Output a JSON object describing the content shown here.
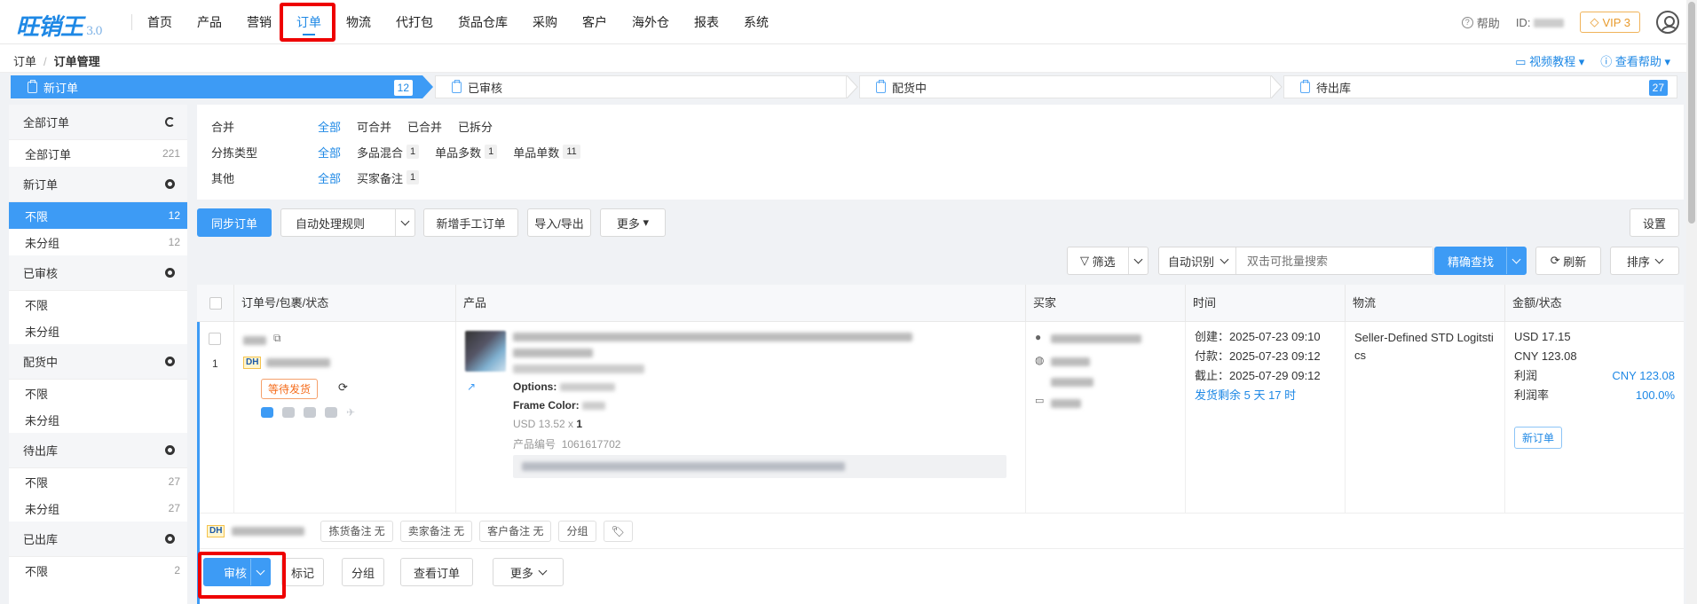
{
  "app": {
    "logo": "旺销王",
    "version": "3.0"
  },
  "nav": [
    {
      "label": "首页"
    },
    {
      "label": "产品"
    },
    {
      "label": "营销"
    },
    {
      "label": "订单"
    },
    {
      "label": "物流"
    },
    {
      "label": "代打包"
    },
    {
      "label": "货品仓库"
    },
    {
      "label": "采购"
    },
    {
      "label": "客户"
    },
    {
      "label": "海外仓"
    },
    {
      "label": "报表"
    },
    {
      "label": "系统"
    }
  ],
  "topRight": {
    "help": "帮助",
    "idLabel": "ID:",
    "vip": "VIP 3"
  },
  "breadcrumb": {
    "root": "订单",
    "sep": "/",
    "current": "订单管理"
  },
  "crumbRight": {
    "video": "视频教程",
    "help": "查看帮助"
  },
  "steps": [
    {
      "label": "新订单",
      "count": "12"
    },
    {
      "label": "已审核",
      "count": ""
    },
    {
      "label": "配货中",
      "count": ""
    },
    {
      "label": "待出库",
      "count": "27"
    }
  ],
  "sidebar": {
    "all": {
      "title": "全部订单",
      "items": [
        {
          "label": "全部订单",
          "count": "221"
        }
      ]
    },
    "groups": [
      {
        "title": "新订单",
        "items": [
          {
            "label": "不限",
            "count": "12"
          },
          {
            "label": "未分组",
            "count": "12"
          }
        ]
      },
      {
        "title": "已审核",
        "items": [
          {
            "label": "不限",
            "count": ""
          },
          {
            "label": "未分组",
            "count": ""
          }
        ]
      },
      {
        "title": "配货中",
        "items": [
          {
            "label": "不限",
            "count": ""
          },
          {
            "label": "未分组",
            "count": ""
          }
        ]
      },
      {
        "title": "待出库",
        "items": [
          {
            "label": "不限",
            "count": "27"
          },
          {
            "label": "未分组",
            "count": "27"
          }
        ]
      },
      {
        "title": "已出库",
        "items": [
          {
            "label": "不限",
            "count": "2"
          }
        ]
      }
    ]
  },
  "filters": {
    "merge": {
      "label": "合并",
      "options": [
        "全部",
        "可合并",
        "已合并",
        "已拆分"
      ]
    },
    "sort": {
      "label": "分拣类型",
      "all": "全部",
      "options": [
        {
          "label": "多品混合",
          "n": "1"
        },
        {
          "label": "单品多数",
          "n": "1"
        },
        {
          "label": "单品单数",
          "n": "11"
        }
      ]
    },
    "other": {
      "label": "其他",
      "all": "全部",
      "options": [
        {
          "label": "买家备注",
          "n": "1"
        }
      ]
    }
  },
  "toolbar": {
    "sync": "同步订单",
    "autoRule": "自动处理规则",
    "newManual": "新增手工订单",
    "importExport": "导入/导出",
    "more": "更多",
    "settings": "设置",
    "filter": "筛选",
    "autoDetect": "自动识别",
    "searchPlaceholder": "双击可批量搜索",
    "exactSearch": "精确查找",
    "refresh": "刷新",
    "sortBtn": "排序"
  },
  "table": {
    "headers": [
      "订单号/包裹/状态",
      "产品",
      "买家",
      "时间",
      "物流",
      "金额/状态"
    ],
    "row": {
      "index": "1",
      "status": "等待发货",
      "options": "Options:",
      "frameColor": "Frame Color:",
      "price": "USD 13.52 x",
      "qty": "1",
      "productCodeLabel": "产品编号",
      "productCode": "1061617702",
      "created": "创建：2025-07-23 09:10",
      "paid": "付款：2025-07-23 09:12",
      "deadline": "截止：2025-07-29 09:12",
      "remaining": "发货剩余 5 天 17 时",
      "logistics": "Seller-Defined STD Logitstics",
      "usd": "USD 17.15",
      "cny": "CNY 123.08",
      "profitLabel": "利润",
      "profit": "CNY 123.08",
      "marginLabel": "利润率",
      "margin": "100.0%",
      "stateTag": "新订单",
      "remarks": {
        "pick": "拣货备注 无",
        "seller": "卖家备注 无",
        "buyer": "客户备注 无",
        "group": "分组"
      },
      "actions": {
        "audit": "审核",
        "mark": "标记",
        "group": "分组",
        "view": "查看订单",
        "more": "更多"
      }
    }
  },
  "colors": {
    "accent": "#3d9bf5",
    "highlight": "#e00000",
    "warn": "#f56c1b"
  }
}
